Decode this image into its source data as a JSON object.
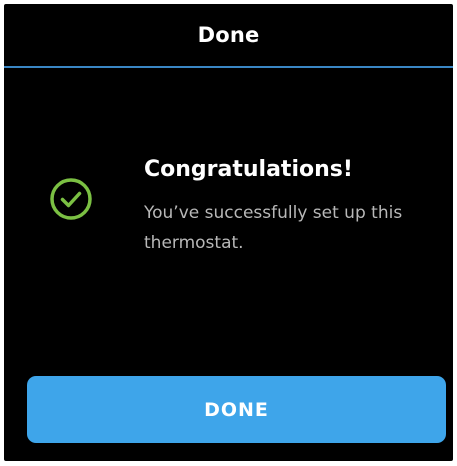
{
  "header": {
    "title": "Done"
  },
  "content": {
    "icon": "check-circle-icon",
    "title": "Congratulations!",
    "message": "You’ve successfully set up this thermostat."
  },
  "actions": {
    "done_label": "DONE"
  },
  "colors": {
    "background": "#000000",
    "accent_line": "#3a86c4",
    "success": "#7bc043",
    "button": "#3ea5ea"
  }
}
